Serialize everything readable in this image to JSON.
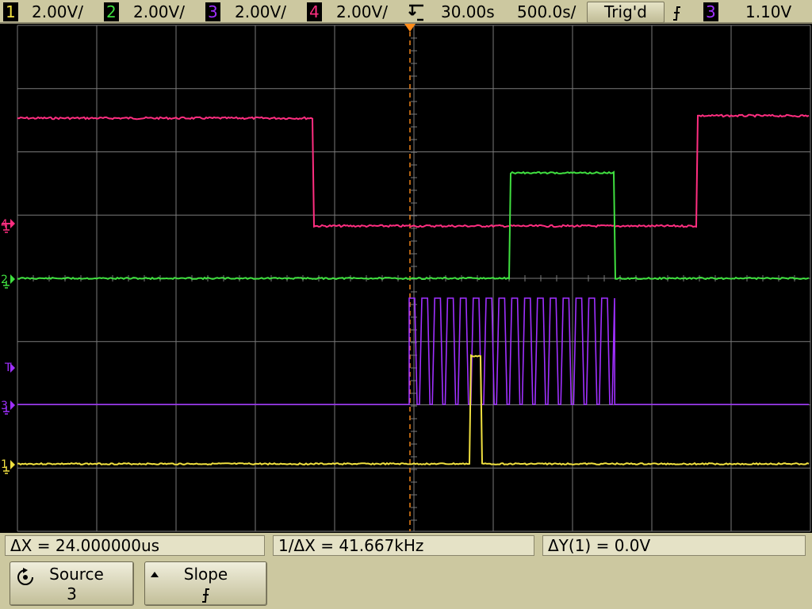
{
  "colors": {
    "ch1": "#f0e040",
    "ch2": "#40e040",
    "ch3": "#a030ff",
    "ch4": "#ff2e80",
    "trigger_marker": "#ff8c1a",
    "grid": "#7a7a7a",
    "panel": "#ccc8a0"
  },
  "status_bar": {
    "ch1": {
      "number": "1",
      "scale": "2.00V/"
    },
    "ch2": {
      "number": "2",
      "scale": "2.00V/"
    },
    "ch3": {
      "number": "3",
      "scale": "2.00V/"
    },
    "ch4": {
      "number": "4",
      "scale": "2.00V/"
    },
    "delay": "30.00s",
    "timebase": "500.0s/",
    "trigger_status": "Trig'd",
    "trigger_source": "3",
    "trigger_level": "1.10V"
  },
  "markers": {
    "ch1": "1",
    "ch2": "2",
    "ch3": "3",
    "ch4": "4",
    "trigger": "T"
  },
  "measurements": {
    "delta_x": "ΔX = 24.000000us",
    "inv_delta_x": "1/ΔX = 41.667kHz",
    "delta_y": "ΔY(1) = 0.0V"
  },
  "softkeys": {
    "source": {
      "label": "Source",
      "value": "3"
    },
    "slope": {
      "label": "Slope",
      "value": "rising-edge-icon"
    }
  }
}
